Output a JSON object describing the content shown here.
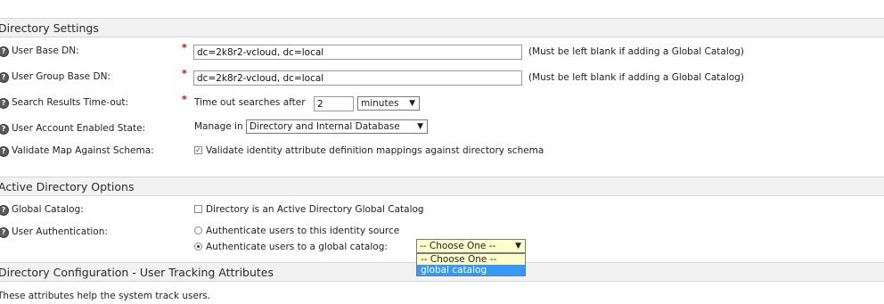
{
  "sections": {
    "directory_settings": "Directory Settings",
    "ad_options": "Active Directory Options",
    "tracking": "Directory Configuration - User Tracking Attributes"
  },
  "fields": {
    "user_base_dn": {
      "label": "User Base DN:",
      "value": "dc=2k8r2-vcloud, dc=local",
      "note": "(Must be left blank if adding a Global Catalog)"
    },
    "user_group_base_dn": {
      "label": "User Group Base DN:",
      "value": "dc=2k8r2-vcloud, dc=local",
      "note": "(Must be left blank if adding a Global Catalog)"
    },
    "search_timeout": {
      "label": "Search Results Time-out:",
      "prefix": "Time out searches after",
      "value": "2",
      "unit": "minutes"
    },
    "account_enabled": {
      "label": "User Account Enabled State:",
      "prefix": "Manage in",
      "value": "Directory and Internal Database"
    },
    "validate_map": {
      "label": "Validate Map Against Schema:",
      "checkbox_label": "Validate identity attribute definition mappings against directory schema",
      "checked": true
    },
    "global_catalog": {
      "label": "Global Catalog:",
      "checkbox_label": "Directory is an Active Directory Global Catalog",
      "checked": false
    },
    "user_auth": {
      "label": "User Authentication:",
      "option1": "Authenticate users to this identity source",
      "option2": "Authenticate users to a global catalog:",
      "selected": "option2",
      "dropdown_value": "-- Choose One --",
      "dropdown_options": [
        "-- Choose One --",
        "global catalog"
      ]
    }
  },
  "tracking_text": "These attributes help the system track users.",
  "icons": {
    "help": "?",
    "check": "✓",
    "arrow": "▼"
  },
  "colors": {
    "required": "#d40000",
    "highlight": "#3399ff",
    "selected_option": "#ffffcc"
  }
}
